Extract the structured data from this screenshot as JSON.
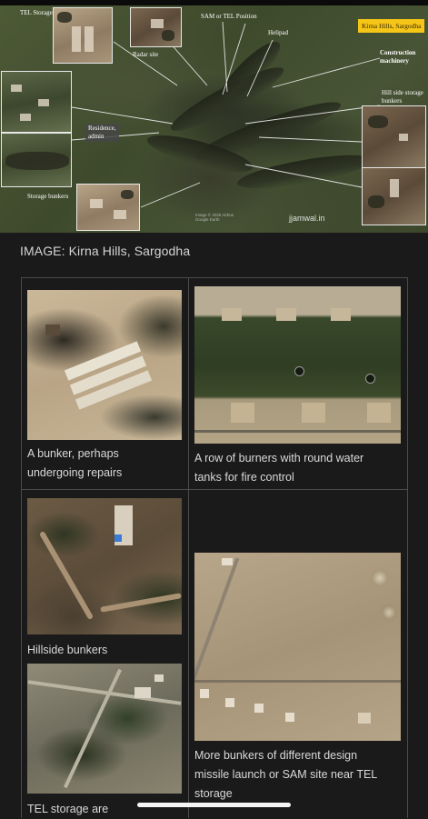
{
  "hero": {
    "title_label": "Kirna Hills, Sargodha",
    "watermark": "jjamwal.in",
    "credit": "Image © 2025 Airbus\nGoogle Earth",
    "labels": {
      "tel_storage": "TEL Storage",
      "sam_tel": "SAM or TEL Position",
      "radar": "Radar site",
      "helipad": "Helipad",
      "construction": "Construction\nmachinery",
      "hill_bunkers": "Hill side storage\nbunkers",
      "residence": "Residence,\nadmin",
      "storage_bunkers": "Storage bunkers"
    }
  },
  "caption": "IMAGE: Kirna Hills, Sargodha",
  "gallery": {
    "items": [
      {
        "caption": "A bunker, perhaps\nundergoing repairs"
      },
      {
        "caption": "A row of burners with round water\ntanks for fire control"
      },
      {
        "caption": "Hillside bunkers"
      },
      {
        "caption": "More bunkers of different design\nmissile launch or SAM site near TEL\nstorage"
      },
      {
        "caption": "TEL storage are"
      }
    ]
  },
  "colors": {
    "background": "#1a1a1a",
    "title_badge": "#f5c518",
    "text": "#d9d9d9",
    "grid_line": "#4a4a4a"
  }
}
